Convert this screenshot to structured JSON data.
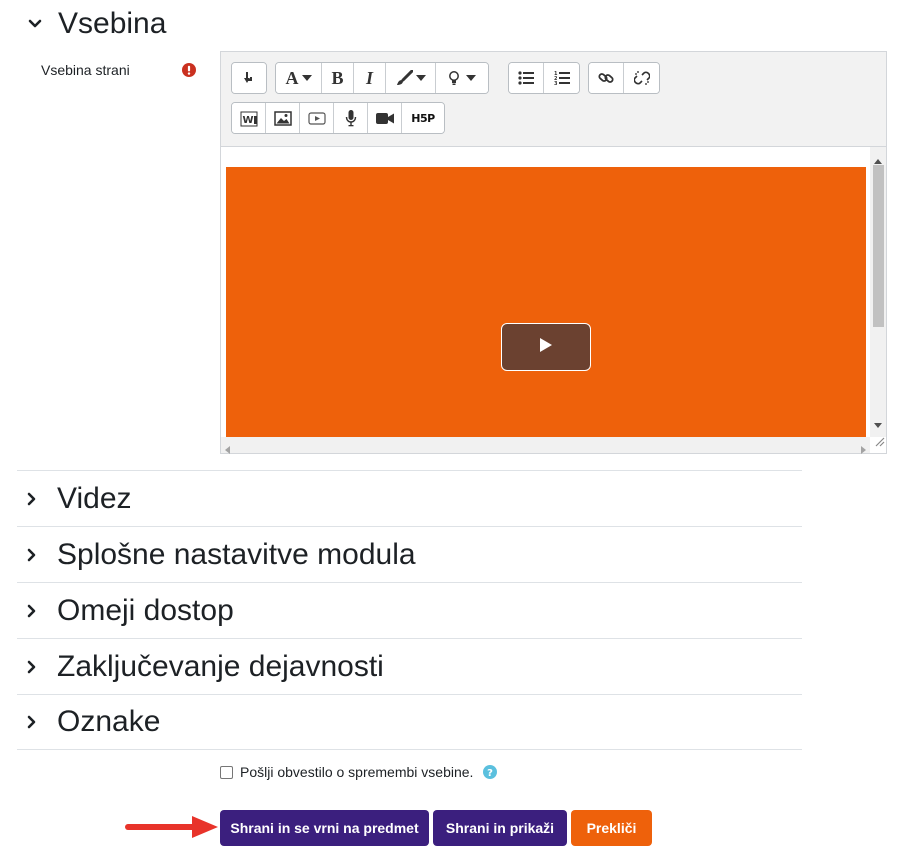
{
  "section_open": {
    "title": "Vsebina",
    "field_label": "Vsebina strani"
  },
  "editor": {
    "toolbar": {
      "row1": [
        "insert-icon",
        "font-icon",
        "bold-icon",
        "italic-icon",
        "brush-icon",
        "lightbulb-icon",
        "bullet-list-icon",
        "numbered-list-icon",
        "link-icon",
        "unlink-icon"
      ],
      "row2": [
        "word-paste-icon",
        "image-icon",
        "media-icon",
        "microphone-icon",
        "video-camera-icon",
        "h5p-icon"
      ],
      "font_glyph": "A",
      "bold_glyph": "B",
      "italic_glyph": "I",
      "h5p_text": "H5P"
    },
    "video_color": "#ee610b"
  },
  "sections": [
    {
      "title": "Videz"
    },
    {
      "title": "Splošne nastavitve modula"
    },
    {
      "title": "Omeji dostop"
    },
    {
      "title": "Zaključevanje dejavnosti"
    },
    {
      "title": "Oznake"
    }
  ],
  "notify": {
    "label": "Pošlji obvestilo o spremembi vsebine.",
    "checked": false
  },
  "buttons": {
    "save_return": "Shrani in se vrni na predmet",
    "save_display": "Shrani in prikaži",
    "cancel": "Prekliči"
  },
  "colors": {
    "primary": "#3b1f7e",
    "cancel": "#ee610b",
    "required": "#ca3120",
    "help": "#5bc0de",
    "pointer_arrow": "#e8332a"
  }
}
